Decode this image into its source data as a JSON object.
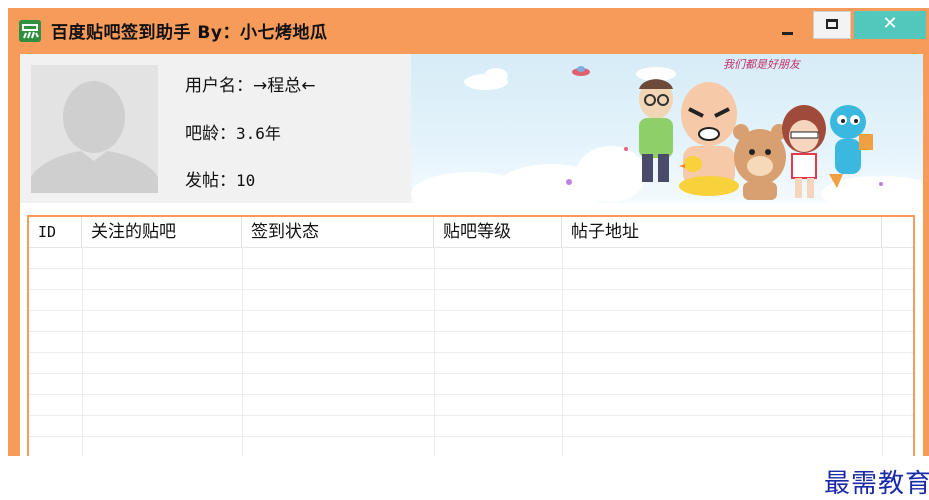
{
  "window": {
    "title": "百度贴吧签到助手  By：小七烤地瓜",
    "controls": {
      "minimize": "minimize",
      "maximize": "maximize",
      "close": "✕"
    },
    "colors": {
      "frame": "#f79b5b",
      "close": "#52c8bd"
    }
  },
  "profile": {
    "username_label": "用户名：",
    "username_value": "→程总←",
    "age_label": "吧龄：",
    "age_value": "3.6年",
    "posts_label": "发帖：",
    "posts_value": "10"
  },
  "banner": {
    "handwriting": "我们都是好朋友"
  },
  "table": {
    "columns": [
      "ID",
      "关注的贴吧",
      "签到状态",
      "贴吧等级",
      "帖子地址"
    ],
    "rows": []
  },
  "watermark": "最需教育"
}
